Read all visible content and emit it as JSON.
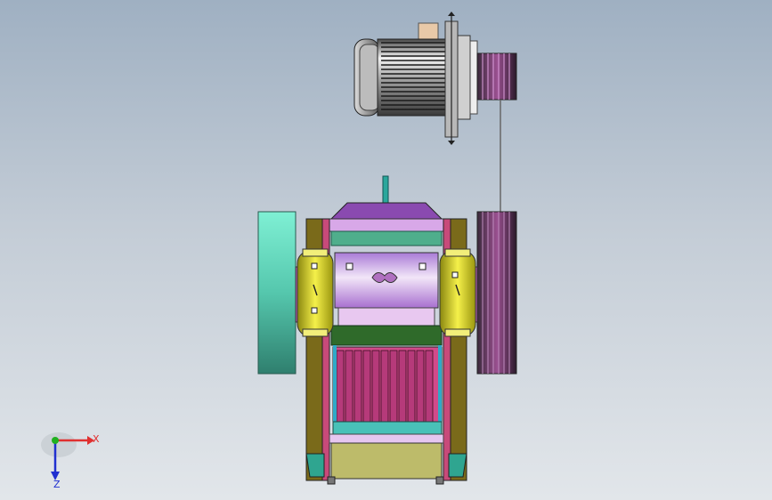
{
  "viewport": {
    "name": "3d-model-viewport",
    "background_top": "#9fb0c2",
    "background_bottom": "#e2e6ea"
  },
  "triad": {
    "x_label": "X",
    "z_label": "Z",
    "x_color": "#e03030",
    "y_color": "#20b020",
    "z_color": "#2030d0"
  },
  "model": {
    "components": [
      "motor-body-icon",
      "motor-pulley-icon",
      "drive-belt-icon",
      "driven-pulley-icon",
      "flywheel-icon",
      "crusher-frame-icon",
      "bearing-housing-icon",
      "jaw-plate-icon",
      "discharge-hopper-icon"
    ],
    "colors": {
      "motor": "#c8c8c8",
      "frame_olive": "#7a6a1a",
      "frame_teal": "#1f8a86",
      "flywheel": "#5fd3b8",
      "bearing": "#e6e01e",
      "chamber": "#c896e0",
      "pulley": "#6e2a6a",
      "hopper": "#bdbb6a"
    }
  }
}
